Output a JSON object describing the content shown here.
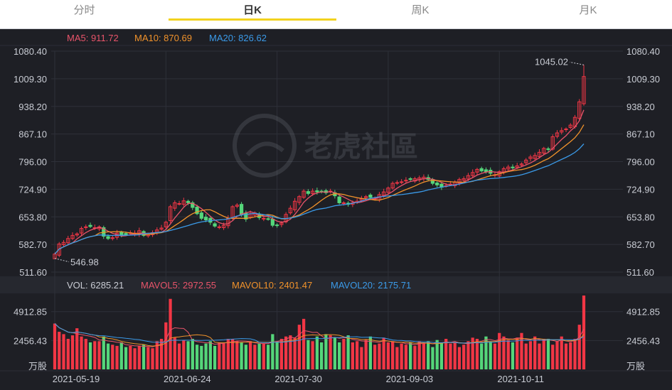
{
  "tabs": [
    {
      "label": "分时",
      "active": false
    },
    {
      "label": "日K",
      "active": true
    },
    {
      "label": "周K",
      "active": false
    },
    {
      "label": "月K",
      "active": false
    }
  ],
  "price_legend": [
    {
      "label": "MA5: 911.72",
      "color": "#e8546a"
    },
    {
      "label": "MA10: 870.69",
      "color": "#f0922b"
    },
    {
      "label": "MA20: 826.62",
      "color": "#3b9ae8"
    }
  ],
  "volume_legend": [
    {
      "label": "VOL: 6285.21",
      "color": "#c9ccd4"
    },
    {
      "label": "MAVOL5: 2972.55",
      "color": "#e8546a"
    },
    {
      "label": "MAVOL10: 2401.47",
      "color": "#f0922b"
    },
    {
      "label": "MAVOL20: 2175.71",
      "color": "#3b9ae8"
    }
  ],
  "watermark": "老虎社區",
  "colors": {
    "up": "#f23645",
    "down": "#55d67a",
    "ma5": "#e8546a",
    "ma10": "#f0922b",
    "ma20": "#3b9ae8"
  },
  "chart_data": {
    "type": "candlestick",
    "price_axis": {
      "ticks": [
        "1080.40",
        "1009.30",
        "938.20",
        "867.10",
        "796.00",
        "724.90",
        "653.80",
        "582.70",
        "511.60"
      ],
      "range": [
        511.6,
        1080.4
      ]
    },
    "volume_axis": {
      "ticks": [
        "4912.85",
        "2456.43"
      ],
      "unit": "万股",
      "range": [
        0,
        6285.21
      ]
    },
    "date_labels": [
      "2021-05-19",
      "2021-06-24",
      "2021-07-30",
      "2021-09-03",
      "2021-10-11"
    ],
    "date_label_index": [
      0,
      25,
      50,
      75,
      100
    ],
    "annotations": {
      "high": "1045.02",
      "low": "546.98"
    },
    "close": [
      558,
      584,
      588,
      598,
      606,
      610,
      624,
      628,
      629,
      626,
      628,
      604,
      598,
      600,
      612,
      608,
      608,
      613,
      612,
      618,
      606,
      608,
      613,
      620,
      625,
      640,
      680,
      690,
      688,
      695,
      690,
      678,
      662,
      650,
      646,
      640,
      630,
      628,
      632,
      650,
      680,
      684,
      660,
      648,
      662,
      664,
      652,
      650,
      648,
      632,
      632,
      638,
      660,
      676,
      694,
      706,
      720,
      714,
      720,
      718,
      718,
      716,
      720,
      708,
      690,
      690,
      686,
      690,
      694,
      700,
      706,
      704,
      700,
      711,
      718,
      728,
      740,
      742,
      744,
      748,
      750,
      752,
      754,
      756,
      750,
      740,
      736,
      730,
      734,
      738,
      744,
      750,
      752,
      760,
      768,
      776,
      772,
      770,
      766,
      762,
      770,
      778,
      782,
      780,
      785,
      790,
      800,
      808,
      812,
      820,
      830,
      828,
      860,
      870,
      876,
      880,
      890,
      910,
      950,
      1015
    ],
    "volume": [
      3900,
      3200,
      3000,
      2600,
      2900,
      3500,
      2800,
      2600,
      2300,
      2400,
      2400,
      2800,
      2200,
      2100,
      2000,
      2300,
      1900,
      2000,
      1800,
      2000,
      2100,
      1900,
      1800,
      2400,
      2600,
      4000,
      6000,
      2700,
      2200,
      2500,
      2400,
      2600,
      2100,
      2000,
      2200,
      2400,
      2000,
      2300,
      2200,
      2600,
      2600,
      2400,
      2300,
      2100,
      2400,
      2100,
      2200,
      2200,
      2100,
      3000,
      2400,
      2600,
      2800,
      2900,
      2700,
      3800,
      4300,
      2500,
      2400,
      2800,
      2300,
      3000,
      2900,
      2700,
      2300,
      2600,
      2900,
      2300,
      2400,
      1900,
      2500,
      2800,
      2100,
      2200,
      2700,
      2300,
      2400,
      1900,
      2200,
      2100,
      2300,
      2000,
      2400,
      2200,
      2400,
      1900,
      2500,
      2300,
      2600,
      2200,
      2300,
      1900,
      2100,
      2400,
      2700,
      2600,
      2200,
      2800,
      2400,
      2200,
      3100,
      2800,
      2500,
      2300,
      2700,
      3100,
      2200,
      2400,
      2800,
      2200,
      2600,
      2600,
      2100,
      2400,
      2800,
      2200,
      2300,
      2600,
      3800,
      6285.21
    ],
    "ma5_last": 911.72,
    "ma10_last": 870.69,
    "ma20_last": 826.62
  }
}
